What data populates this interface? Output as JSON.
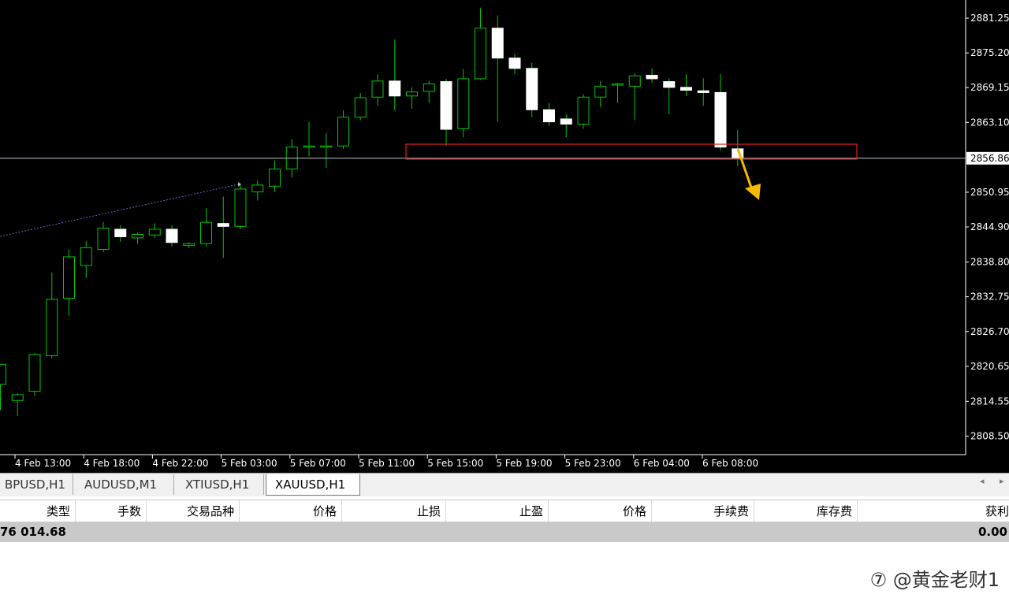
{
  "chart": {
    "symbol": "XAUUSD",
    "timeframe": "H1",
    "current_price": "2856.86",
    "price_scale": [
      "2881.25",
      "2875.20",
      "2869.15",
      "2863.10",
      "2850.95",
      "2844.90",
      "2838.80",
      "2832.75",
      "2826.70",
      "2820.65",
      "2814.55",
      "2808.50"
    ],
    "time_labels": [
      "4 Feb 13:00",
      "4 Feb 18:00",
      "4 Feb 22:00",
      "5 Feb 03:00",
      "5 Feb 07:00",
      "5 Feb 11:00",
      "5 Feb 15:00",
      "5 Feb 19:00",
      "5 Feb 23:00",
      "6 Feb 04:00",
      "6 Feb 08:00"
    ],
    "colors": {
      "background": "#000000",
      "bull_body": "#000000",
      "bear_body": "#ffffff",
      "wick": "#00c800",
      "current_price_line": "#b8c4cc",
      "zone_box": "#e0201e",
      "arrow": "#f5b800",
      "trendline": "#6a5acd"
    },
    "annotations": {
      "support_zone": {
        "price_top": 2859.3,
        "price_bottom": 2856.7
      },
      "arrow_direction": "down"
    }
  },
  "chart_data": {
    "type": "candlestick",
    "candles": [
      {
        "o": 2817.5,
        "h": 2821.0,
        "l": 2813.0,
        "c": 2821.0
      },
      {
        "o": 2814.7,
        "h": 2816.0,
        "l": 2812.0,
        "c": 2815.7
      },
      {
        "o": 2816.3,
        "h": 2823.0,
        "l": 2815.5,
        "c": 2822.7
      },
      {
        "o": 2822.5,
        "h": 2837.0,
        "l": 2822.0,
        "c": 2832.3
      },
      {
        "o": 2832.5,
        "h": 2841.0,
        "l": 2829.5,
        "c": 2839.7
      },
      {
        "o": 2838.2,
        "h": 2842.5,
        "l": 2836.0,
        "c": 2841.3
      },
      {
        "o": 2841.0,
        "h": 2845.8,
        "l": 2840.5,
        "c": 2844.7
      },
      {
        "o": 2844.5,
        "h": 2845.2,
        "l": 2842.3,
        "c": 2843.2
      },
      {
        "o": 2843.0,
        "h": 2843.9,
        "l": 2842.0,
        "c": 2843.6
      },
      {
        "o": 2843.5,
        "h": 2845.5,
        "l": 2843.0,
        "c": 2844.5
      },
      {
        "o": 2844.5,
        "h": 2845.2,
        "l": 2841.5,
        "c": 2842.2
      },
      {
        "o": 2841.7,
        "h": 2842.2,
        "l": 2841.2,
        "c": 2842.0
      },
      {
        "o": 2842.0,
        "h": 2848.2,
        "l": 2841.5,
        "c": 2845.7
      },
      {
        "o": 2845.5,
        "h": 2850.2,
        "l": 2839.5,
        "c": 2845.0
      },
      {
        "o": 2845.0,
        "h": 2852.2,
        "l": 2844.5,
        "c": 2851.5
      },
      {
        "o": 2851.0,
        "h": 2853.0,
        "l": 2849.5,
        "c": 2852.2
      },
      {
        "o": 2852.0,
        "h": 2856.5,
        "l": 2851.0,
        "c": 2855.0
      },
      {
        "o": 2855.0,
        "h": 2860.2,
        "l": 2853.5,
        "c": 2858.8
      },
      {
        "o": 2858.8,
        "h": 2863.2,
        "l": 2857.2,
        "c": 2859.0
      },
      {
        "o": 2859.0,
        "h": 2861.2,
        "l": 2855.2,
        "c": 2859.0
      },
      {
        "o": 2859.0,
        "h": 2865.2,
        "l": 2858.5,
        "c": 2864.0
      },
      {
        "o": 2864.0,
        "h": 2868.2,
        "l": 2863.5,
        "c": 2867.4
      },
      {
        "o": 2867.5,
        "h": 2871.5,
        "l": 2866.0,
        "c": 2870.3
      },
      {
        "o": 2870.3,
        "h": 2877.5,
        "l": 2865.2,
        "c": 2867.7
      },
      {
        "o": 2867.7,
        "h": 2869.2,
        "l": 2865.5,
        "c": 2868.4
      },
      {
        "o": 2868.5,
        "h": 2870.3,
        "l": 2866.5,
        "c": 2869.8
      },
      {
        "o": 2870.2,
        "h": 2870.7,
        "l": 2859.0,
        "c": 2861.9
      },
      {
        "o": 2862.0,
        "h": 2872.4,
        "l": 2860.5,
        "c": 2870.7
      },
      {
        "o": 2870.7,
        "h": 2883.0,
        "l": 2870.5,
        "c": 2879.5
      },
      {
        "o": 2879.5,
        "h": 2881.7,
        "l": 2863.2,
        "c": 2874.3
      },
      {
        "o": 2874.3,
        "h": 2875.0,
        "l": 2871.5,
        "c": 2872.5
      },
      {
        "o": 2872.5,
        "h": 2873.5,
        "l": 2864.0,
        "c": 2865.3
      },
      {
        "o": 2865.3,
        "h": 2866.5,
        "l": 2862.5,
        "c": 2863.2
      },
      {
        "o": 2863.7,
        "h": 2864.5,
        "l": 2860.5,
        "c": 2862.8
      },
      {
        "o": 2862.8,
        "h": 2868.0,
        "l": 2862.0,
        "c": 2867.5
      },
      {
        "o": 2867.5,
        "h": 2870.3,
        "l": 2865.8,
        "c": 2869.4
      },
      {
        "o": 2869.6,
        "h": 2870.0,
        "l": 2866.5,
        "c": 2869.8
      },
      {
        "o": 2869.4,
        "h": 2871.7,
        "l": 2863.5,
        "c": 2871.2
      },
      {
        "o": 2871.3,
        "h": 2872.5,
        "l": 2870.0,
        "c": 2870.7
      },
      {
        "o": 2870.2,
        "h": 2870.8,
        "l": 2864.5,
        "c": 2869.2
      },
      {
        "o": 2869.2,
        "h": 2871.5,
        "l": 2867.7,
        "c": 2868.7
      },
      {
        "o": 2868.6,
        "h": 2870.8,
        "l": 2866.0,
        "c": 2868.3
      },
      {
        "o": 2868.3,
        "h": 2871.5,
        "l": 2858.2,
        "c": 2858.8
      },
      {
        "o": 2858.5,
        "h": 2861.8,
        "l": 2855.5,
        "c": 2856.9
      }
    ]
  },
  "tabs": [
    {
      "label": "BPUSD,H1"
    },
    {
      "label": "AUDUSD,M1"
    },
    {
      "label": "XTIUSD,H1"
    },
    {
      "label": "XAUUSD,H1"
    }
  ],
  "tab_arrows": {
    "left": "◂",
    "right": "▸"
  },
  "terminal": {
    "columns": [
      "类型",
      "手数",
      "交易品种",
      "价格",
      "止损",
      "止盈",
      "价格",
      "手续费",
      "库存费",
      "获利"
    ],
    "balance_text": "76 014.68",
    "profit_total": "0.00"
  },
  "watermark": "⑦ @黄金老财1"
}
